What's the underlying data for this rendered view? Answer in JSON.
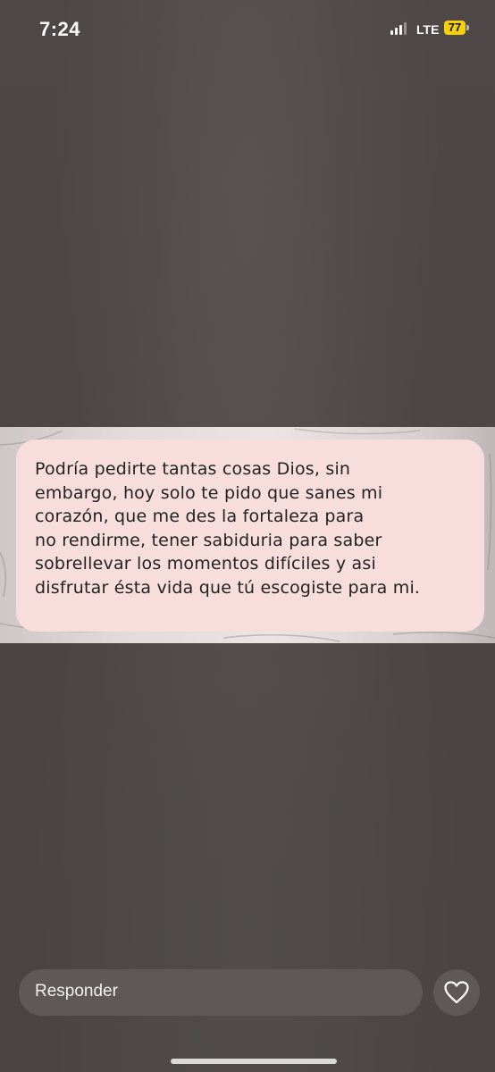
{
  "status_bar": {
    "time": "7:24",
    "network": "LTE",
    "battery": "77",
    "signal_icon": "cellular-signal-icon",
    "battery_color": "#f5d007"
  },
  "story": {
    "text_lines": [
      "Podría pedirte tantas cosas Dios, sin",
      "embargo, hoy solo te pido que sanes mi",
      "corazón, que me des la fortaleza para",
      "no rendirme, tener sabiduria para saber",
      "sobrellevar los momentos difíciles y asi",
      "disfrutar ésta vida que tú escogiste para mi."
    ],
    "card_color": "#f7dedd"
  },
  "reply": {
    "placeholder": "Responder",
    "like_icon": "heart-icon"
  }
}
